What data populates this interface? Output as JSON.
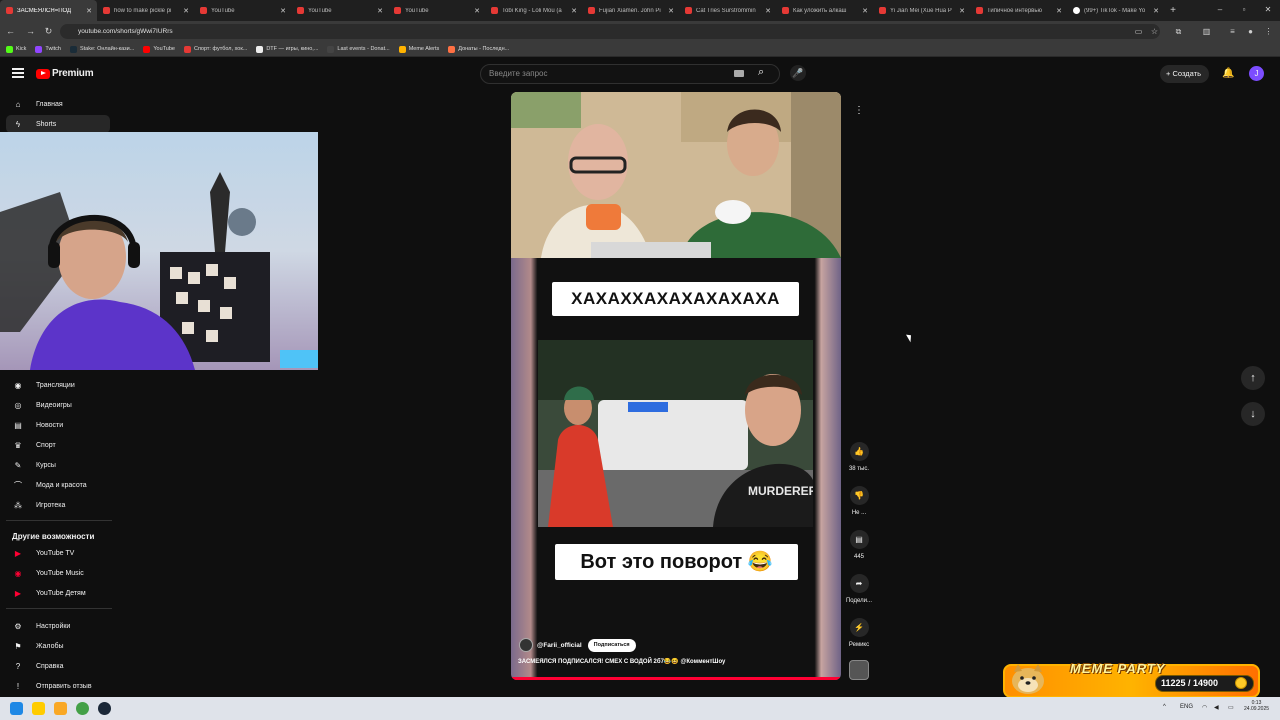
{
  "browser": {
    "tabs": [
      {
        "label": "ЗАСМЕЯЛСЯ=ПОД",
        "active": true
      },
      {
        "label": "how to make pickle pi"
      },
      {
        "label": "YouTube"
      },
      {
        "label": "YouTube"
      },
      {
        "label": "YouTube"
      },
      {
        "label": "Tobi King - Loli Mou (a"
      },
      {
        "label": "Fujian Xiamen. John Pi"
      },
      {
        "label": "Cat Tries Surströmmin"
      },
      {
        "label": "Как уложить алкаш"
      },
      {
        "label": "Yi Jian Mei (Xue Hua P"
      },
      {
        "label": "Типичное интервью"
      },
      {
        "label": "(99+) TikTok - Make Yo"
      }
    ],
    "url": "youtube.com/shorts/gWwi7IURrs",
    "bookmarks": [
      {
        "label": "Kick",
        "color": "#53fc18"
      },
      {
        "label": "Twitch",
        "color": "#9146ff"
      },
      {
        "label": "Stake: Онлайн-кази...",
        "color": "#1a2c38"
      },
      {
        "label": "YouTube",
        "color": "#ff0000"
      },
      {
        "label": "Спорт: футбол, хок...",
        "color": "#e53935"
      },
      {
        "label": "DTF — игры, кино,...",
        "color": "#eeeeee"
      },
      {
        "label": "Last events - Donat...",
        "color": "#444444"
      },
      {
        "label": "Meme Alerts",
        "color": "#ffb300"
      },
      {
        "label": "Донаты - Последн...",
        "color": "#ff7043"
      }
    ]
  },
  "header": {
    "logo_text": "Premium",
    "search_placeholder": "Введите запрос",
    "create_label": "Создать",
    "avatar_letter": "J"
  },
  "sidebar": {
    "top_items": [
      {
        "label": "Главная",
        "icon": "home-icon"
      },
      {
        "label": "Shorts",
        "icon": "shorts-icon",
        "active": true
      }
    ],
    "explore_items": [
      {
        "label": "Трансляции",
        "icon": "live-icon"
      },
      {
        "label": "Видеоигры",
        "icon": "gaming-icon"
      },
      {
        "label": "Новости",
        "icon": "news-icon"
      },
      {
        "label": "Спорт",
        "icon": "trophy-icon"
      },
      {
        "label": "Курсы",
        "icon": "courses-icon"
      },
      {
        "label": "Мода и красота",
        "icon": "hanger-icon"
      },
      {
        "label": "Игротека",
        "icon": "playables-icon"
      }
    ],
    "more_title": "Другие возможности",
    "more_items": [
      {
        "label": "YouTube TV",
        "icon": "youtube-tv-icon"
      },
      {
        "label": "YouTube Music",
        "icon": "youtube-music-icon"
      },
      {
        "label": "YouTube Детям",
        "icon": "youtube-kids-icon"
      }
    ],
    "footer_items": [
      {
        "label": "Настройки",
        "icon": "settings-icon"
      },
      {
        "label": "Жалобы",
        "icon": "flag-icon"
      },
      {
        "label": "Справка",
        "icon": "help-icon"
      },
      {
        "label": "Отправить отзыв",
        "icon": "feedback-icon"
      }
    ]
  },
  "short": {
    "caption_top": "ХАХАХХАХАХАХАХАХА",
    "caption_bottom": "Вот это поворот 😂",
    "channel": "@Farii_official",
    "subscribe_label": "Подписаться",
    "title": "ЗАСМЕЯЛСЯ ПОДПИСАЛСЯ! СМЕХ С ВОДОЙ 2б7😂😆 @КомментШоу",
    "progress": 1.0
  },
  "actions": {
    "likes": "38 тыс.",
    "dislike": "Не ...",
    "comments": "445",
    "share": "Подели...",
    "remix": "Ремикс"
  },
  "overlay": {
    "meme_title": "MEME PARTY",
    "score": "11225 / 14900"
  },
  "taskbar": {
    "lang": "ENG",
    "time": "0:13",
    "date": "24.09.2025"
  }
}
